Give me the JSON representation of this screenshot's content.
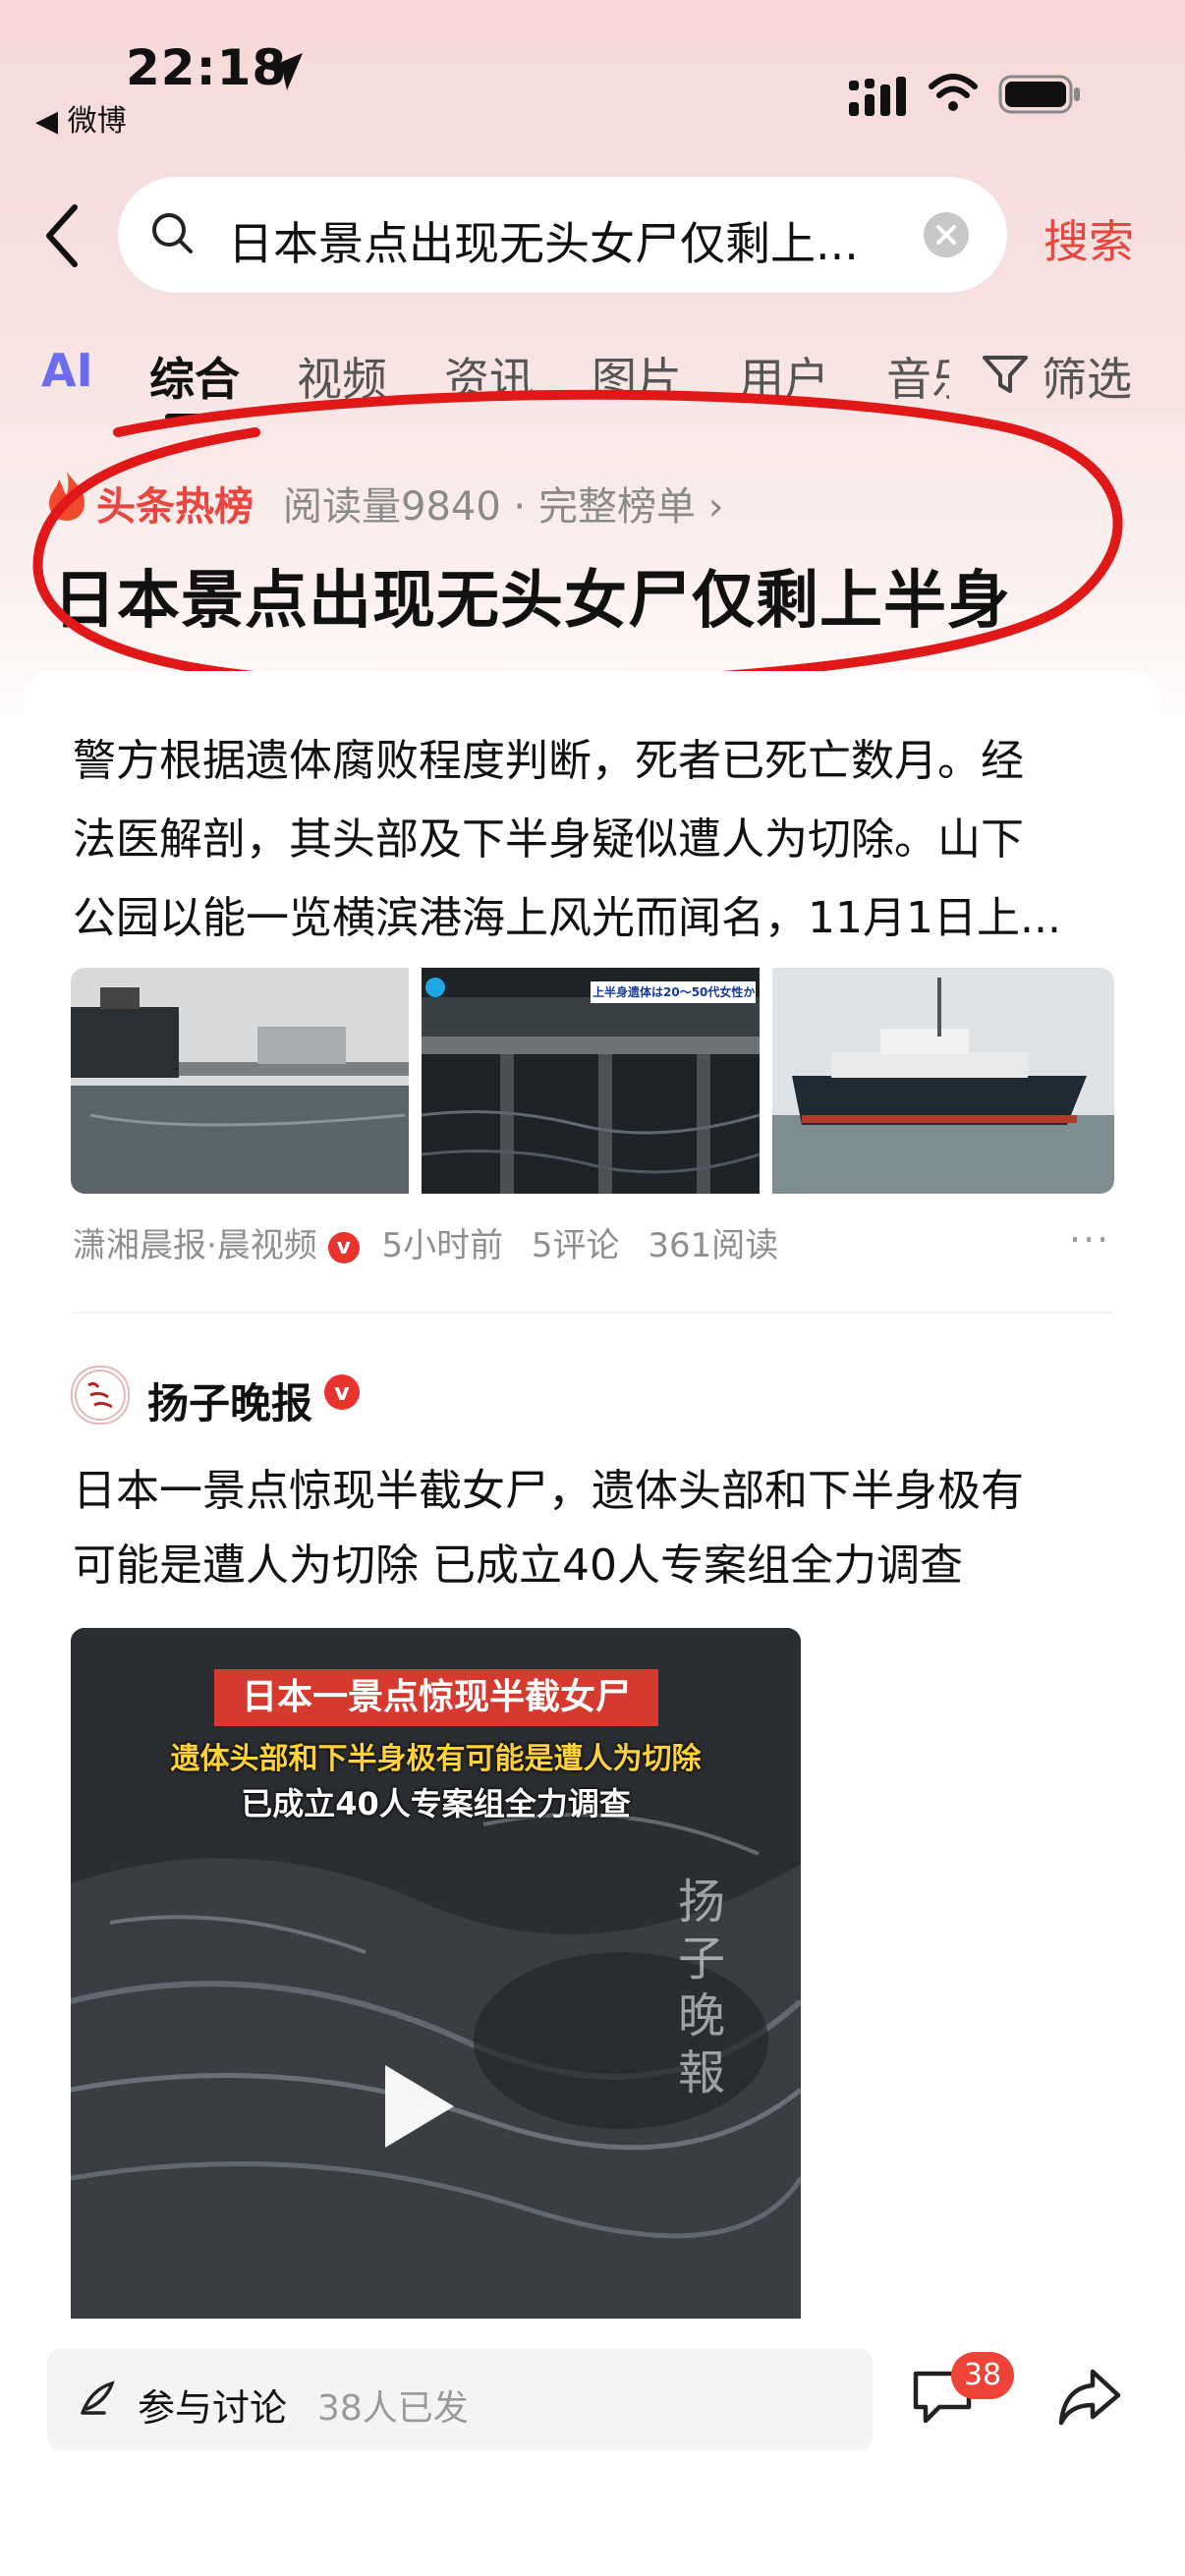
{
  "status_bar": {
    "time": "22:18",
    "back_app": "◀ 微博"
  },
  "search": {
    "query": "日本景点出现无头女尸仅剩上...",
    "button": "搜索"
  },
  "tabs": [
    {
      "label": "AI"
    },
    {
      "label": "综合"
    },
    {
      "label": "视频"
    },
    {
      "label": "资讯"
    },
    {
      "label": "图片"
    },
    {
      "label": "用户"
    },
    {
      "label": "音乐"
    },
    {
      "label": "筛选"
    }
  ],
  "hot": {
    "label": "头条热榜",
    "meta": "阅读量9840 · 完整榜单 ›",
    "headline": "日本景点出现无头女尸仅剩上半身"
  },
  "article": {
    "summary_lines": [
      "警方根据遗体腐败程度判断，死者已死亡数月。经",
      "法医解剖，其头部及下半身疑似遭人为切除。山下",
      "公园以能一览横滨港海上风光而闻名，11月1日上..."
    ],
    "thumb2_tag": "上半身遗体は20～50代女性か",
    "source": "潇湘晨报·晨视频",
    "verified": "v",
    "time": "5小时前",
    "comments": "5评论",
    "reads": "361阅读",
    "more": "···"
  },
  "post": {
    "account": "扬子晚报",
    "verified": "v",
    "avatar_text": "扬子晚报",
    "text_lines": [
      "日本一景点惊现半截女尸，遗体头部和下半身极有",
      "可能是遭人为切除 已成立40人专案组全力调查"
    ],
    "video": {
      "caption1": "日本一景点惊现半截女尸",
      "caption2": "遗体头部和下半身极有可能是遭人为切除",
      "caption3": "已成立40人专案组全力调查",
      "watermark": "扬子晚報"
    }
  },
  "bottom": {
    "discuss_label": "参与讨论",
    "discuss_count": "38人已发",
    "comment_badge": "38"
  },
  "colors": {
    "accent": "#e8463f",
    "verified": "#e8332e"
  }
}
